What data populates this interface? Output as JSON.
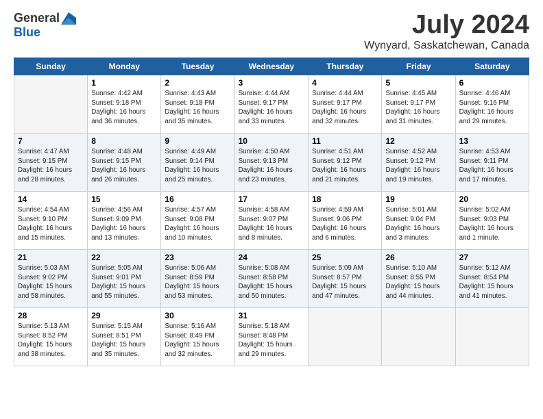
{
  "logo": {
    "general": "General",
    "blue": "Blue"
  },
  "title": "July 2024",
  "location": "Wynyard, Saskatchewan, Canada",
  "days_header": [
    "Sunday",
    "Monday",
    "Tuesday",
    "Wednesday",
    "Thursday",
    "Friday",
    "Saturday"
  ],
  "weeks": [
    [
      {
        "day": "",
        "info": ""
      },
      {
        "day": "1",
        "info": "Sunrise: 4:42 AM\nSunset: 9:18 PM\nDaylight: 16 hours\nand 36 minutes."
      },
      {
        "day": "2",
        "info": "Sunrise: 4:43 AM\nSunset: 9:18 PM\nDaylight: 16 hours\nand 35 minutes."
      },
      {
        "day": "3",
        "info": "Sunrise: 4:44 AM\nSunset: 9:17 PM\nDaylight: 16 hours\nand 33 minutes."
      },
      {
        "day": "4",
        "info": "Sunrise: 4:44 AM\nSunset: 9:17 PM\nDaylight: 16 hours\nand 32 minutes."
      },
      {
        "day": "5",
        "info": "Sunrise: 4:45 AM\nSunset: 9:17 PM\nDaylight: 16 hours\nand 31 minutes."
      },
      {
        "day": "6",
        "info": "Sunrise: 4:46 AM\nSunset: 9:16 PM\nDaylight: 16 hours\nand 29 minutes."
      }
    ],
    [
      {
        "day": "7",
        "info": "Sunrise: 4:47 AM\nSunset: 9:15 PM\nDaylight: 16 hours\nand 28 minutes."
      },
      {
        "day": "8",
        "info": "Sunrise: 4:48 AM\nSunset: 9:15 PM\nDaylight: 16 hours\nand 26 minutes."
      },
      {
        "day": "9",
        "info": "Sunrise: 4:49 AM\nSunset: 9:14 PM\nDaylight: 16 hours\nand 25 minutes."
      },
      {
        "day": "10",
        "info": "Sunrise: 4:50 AM\nSunset: 9:13 PM\nDaylight: 16 hours\nand 23 minutes."
      },
      {
        "day": "11",
        "info": "Sunrise: 4:51 AM\nSunset: 9:12 PM\nDaylight: 16 hours\nand 21 minutes."
      },
      {
        "day": "12",
        "info": "Sunrise: 4:52 AM\nSunset: 9:12 PM\nDaylight: 16 hours\nand 19 minutes."
      },
      {
        "day": "13",
        "info": "Sunrise: 4:53 AM\nSunset: 9:11 PM\nDaylight: 16 hours\nand 17 minutes."
      }
    ],
    [
      {
        "day": "14",
        "info": "Sunrise: 4:54 AM\nSunset: 9:10 PM\nDaylight: 16 hours\nand 15 minutes."
      },
      {
        "day": "15",
        "info": "Sunrise: 4:56 AM\nSunset: 9:09 PM\nDaylight: 16 hours\nand 13 minutes."
      },
      {
        "day": "16",
        "info": "Sunrise: 4:57 AM\nSunset: 9:08 PM\nDaylight: 16 hours\nand 10 minutes."
      },
      {
        "day": "17",
        "info": "Sunrise: 4:58 AM\nSunset: 9:07 PM\nDaylight: 16 hours\nand 8 minutes."
      },
      {
        "day": "18",
        "info": "Sunrise: 4:59 AM\nSunset: 9:06 PM\nDaylight: 16 hours\nand 6 minutes."
      },
      {
        "day": "19",
        "info": "Sunrise: 5:01 AM\nSunset: 9:04 PM\nDaylight: 16 hours\nand 3 minutes."
      },
      {
        "day": "20",
        "info": "Sunrise: 5:02 AM\nSunset: 9:03 PM\nDaylight: 16 hours\nand 1 minute."
      }
    ],
    [
      {
        "day": "21",
        "info": "Sunrise: 5:03 AM\nSunset: 9:02 PM\nDaylight: 15 hours\nand 58 minutes."
      },
      {
        "day": "22",
        "info": "Sunrise: 5:05 AM\nSunset: 9:01 PM\nDaylight: 15 hours\nand 55 minutes."
      },
      {
        "day": "23",
        "info": "Sunrise: 5:06 AM\nSunset: 8:59 PM\nDaylight: 15 hours\nand 53 minutes."
      },
      {
        "day": "24",
        "info": "Sunrise: 5:08 AM\nSunset: 8:58 PM\nDaylight: 15 hours\nand 50 minutes."
      },
      {
        "day": "25",
        "info": "Sunrise: 5:09 AM\nSunset: 8:57 PM\nDaylight: 15 hours\nand 47 minutes."
      },
      {
        "day": "26",
        "info": "Sunrise: 5:10 AM\nSunset: 8:55 PM\nDaylight: 15 hours\nand 44 minutes."
      },
      {
        "day": "27",
        "info": "Sunrise: 5:12 AM\nSunset: 8:54 PM\nDaylight: 15 hours\nand 41 minutes."
      }
    ],
    [
      {
        "day": "28",
        "info": "Sunrise: 5:13 AM\nSunset: 8:52 PM\nDaylight: 15 hours\nand 38 minutes."
      },
      {
        "day": "29",
        "info": "Sunrise: 5:15 AM\nSunset: 8:51 PM\nDaylight: 15 hours\nand 35 minutes."
      },
      {
        "day": "30",
        "info": "Sunrise: 5:16 AM\nSunset: 8:49 PM\nDaylight: 15 hours\nand 32 minutes."
      },
      {
        "day": "31",
        "info": "Sunrise: 5:18 AM\nSunset: 8:48 PM\nDaylight: 15 hours\nand 29 minutes."
      },
      {
        "day": "",
        "info": ""
      },
      {
        "day": "",
        "info": ""
      },
      {
        "day": "",
        "info": ""
      }
    ]
  ]
}
